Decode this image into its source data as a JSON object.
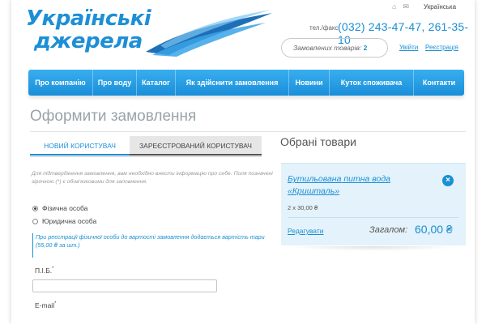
{
  "header": {
    "logo_line1": "Українські",
    "logo_line2": "джерела",
    "language": "Українська",
    "phone_label": "тел./факс:",
    "phone": "(032) 243-47-47, 261-35-10",
    "cart_label": "Замовлених товарів:",
    "cart_count": "2",
    "login": "Увійти",
    "register": "Реєстрація",
    "brand_color": "#1b8fd3"
  },
  "nav": {
    "items": [
      "Про компанію",
      "Про воду",
      "Каталог",
      "Як здійснити замовлення",
      "Новини",
      "Куток споживача",
      "Контакти"
    ]
  },
  "main": {
    "title": "Оформити замовлення",
    "tabs": [
      {
        "label": "Новий користувач",
        "active": true
      },
      {
        "label": "Зареєстрований користувач",
        "active": false
      }
    ],
    "note": "Для підтвердження замовлення, вам необхідно внести інформацію про себе. Поля позначені зірочкою (*) є обов'язковими для заповнення.",
    "radio_options": [
      {
        "label": "Фізична особа",
        "checked": true
      },
      {
        "label": "Юридична особа",
        "checked": false
      }
    ],
    "blue_note": "При реєстрації фізичної особи до вартості замовлення додається вартість тари (55,00 ₴ за шт.)",
    "fio_label": "П.І.Б.",
    "fio_value": "",
    "email_label": "E-mail",
    "required_mark": "*"
  },
  "goods": {
    "title": "Обрані товари",
    "product_name": "Бутильована питна вода «Кришталь»",
    "qty": "2 x 30,00 ₴",
    "edit": "Редагувати",
    "total_label": "Загалом:",
    "total_value": "60,00 ₴",
    "close_symbol": "×"
  }
}
